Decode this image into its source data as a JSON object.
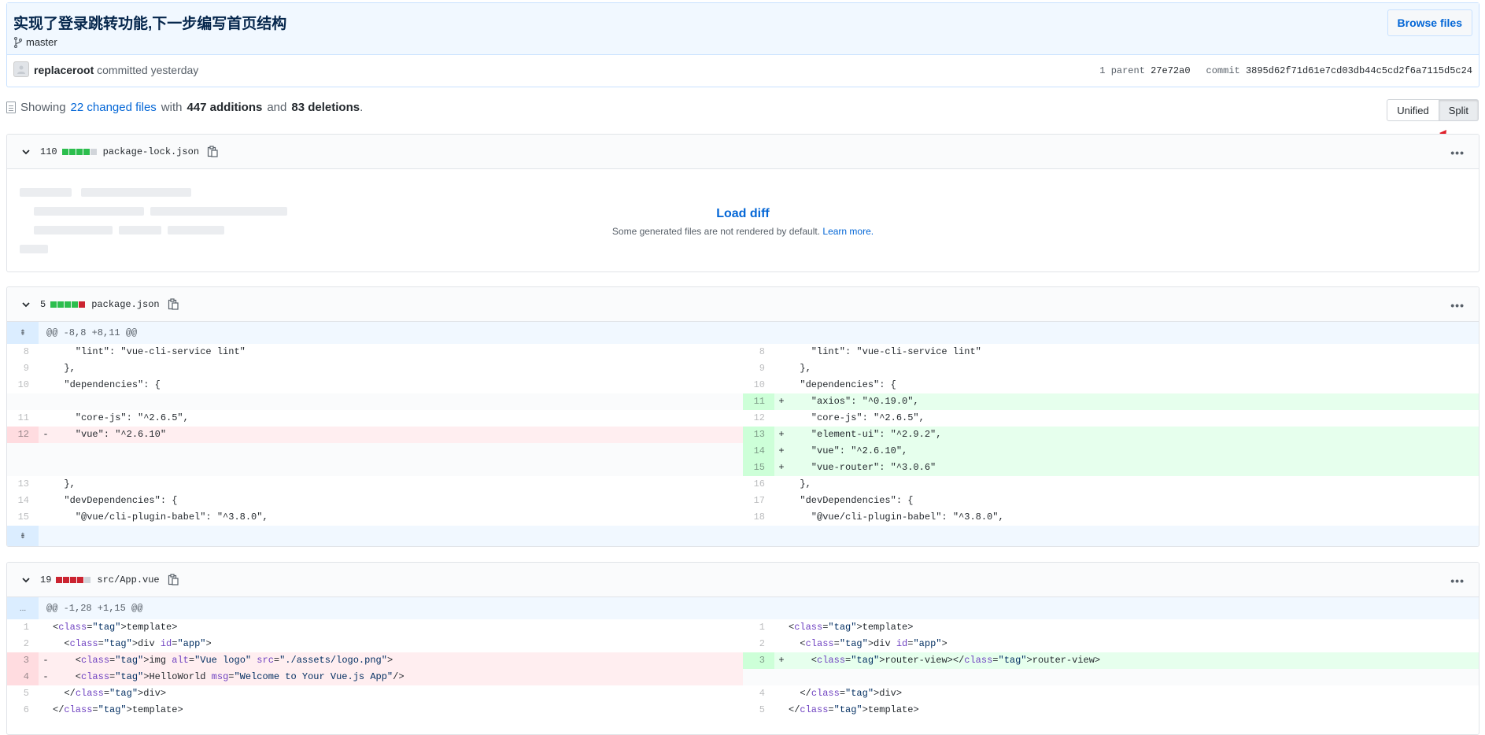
{
  "commit": {
    "title": "实现了登录跳转功能,下一步编写首页结构",
    "branch": "master",
    "browse_label": "Browse files",
    "author": "replaceroot",
    "action": "committed yesterday",
    "parent_label": "1 parent",
    "parent_sha": "27e72a0",
    "commit_label": "commit",
    "commit_sha": "3895d62f71d61e7cd03db44c5cd2f6a7115d5c24"
  },
  "toc": {
    "prefix": "Showing",
    "changed_files": "22 changed files",
    "with": "with",
    "additions": "447 additions",
    "and": "and",
    "deletions": "83 deletions",
    "period": "."
  },
  "view_toggle": {
    "unified": "Unified",
    "split": "Split"
  },
  "colors": {
    "add_block": "#2cbe4e",
    "del_block": "#cb2431",
    "neutral_block": "#d1d5da",
    "arrow": "#e0202a"
  },
  "files": [
    {
      "count": "110",
      "name": "package-lock.json",
      "blocks": [
        "add",
        "add",
        "add",
        "add",
        "neutral"
      ],
      "load_link": "Load diff",
      "load_note": "Some generated files are not rendered by default.",
      "load_note_link": "Learn more."
    },
    {
      "count": "5",
      "name": "package.json",
      "blocks": [
        "add",
        "add",
        "add",
        "add",
        "del"
      ],
      "hunk": "@@ -8,8 +8,11 @@",
      "rows": [
        {
          "ln": "8",
          "lt": "ctx",
          "lc": "    \"lint\": \"vue-cli-service lint\"",
          "rn": "8",
          "rt": "ctx",
          "rc": "    \"lint\": \"vue-cli-service lint\""
        },
        {
          "ln": "9",
          "lt": "ctx",
          "lc": "  },",
          "rn": "9",
          "rt": "ctx",
          "rc": "  },"
        },
        {
          "ln": "10",
          "lt": "ctx",
          "lc": "  \"dependencies\": {",
          "rn": "10",
          "rt": "ctx",
          "rc": "  \"dependencies\": {"
        },
        {
          "ln": "",
          "lt": "empty",
          "lc": "",
          "rn": "11",
          "rt": "add",
          "rc": "    \"axios\": \"^0.19.0\","
        },
        {
          "ln": "11",
          "lt": "ctx",
          "lc": "    \"core-js\": \"^2.6.5\",",
          "rn": "12",
          "rt": "ctx",
          "rc": "    \"core-js\": \"^2.6.5\","
        },
        {
          "ln": "12",
          "lt": "del",
          "lc": "    \"vue\": \"^2.6.10\"",
          "rn": "13",
          "rt": "add",
          "rc": "    \"element-ui\": \"^2.9.2\","
        },
        {
          "ln": "",
          "lt": "empty",
          "lc": "",
          "rn": "14",
          "rt": "add",
          "rc": "    \"vue\": \"^2.6.10\","
        },
        {
          "ln": "",
          "lt": "empty",
          "lc": "",
          "rn": "15",
          "rt": "add",
          "rc": "    \"vue-router\": \"^3.0.6\""
        },
        {
          "ln": "13",
          "lt": "ctx",
          "lc": "  },",
          "rn": "16",
          "rt": "ctx",
          "rc": "  },"
        },
        {
          "ln": "14",
          "lt": "ctx",
          "lc": "  \"devDependencies\": {",
          "rn": "17",
          "rt": "ctx",
          "rc": "  \"devDependencies\": {"
        },
        {
          "ln": "15",
          "lt": "ctx",
          "lc": "    \"@vue/cli-plugin-babel\": \"^3.8.0\",",
          "rn": "18",
          "rt": "ctx",
          "rc": "    \"@vue/cli-plugin-babel\": \"^3.8.0\","
        }
      ]
    },
    {
      "count": "19",
      "name": "src/App.vue",
      "blocks": [
        "del",
        "del",
        "del",
        "del",
        "neutral"
      ],
      "hunk": "@@ -1,28 +1,15 @@",
      "hunk_expander": "...",
      "rows": [
        {
          "ln": "1",
          "lt": "ctx",
          "lc": "<template>",
          "rn": "1",
          "rt": "ctx",
          "rc": "<template>"
        },
        {
          "ln": "2",
          "lt": "ctx",
          "lc": "  <div id=\"app\">",
          "rn": "2",
          "rt": "ctx",
          "rc": "  <div id=\"app\">"
        },
        {
          "ln": "3",
          "lt": "del",
          "lc": "    <img alt=\"Vue logo\" src=\"./assets/logo.png\">",
          "rn": "3",
          "rt": "add",
          "rc": "    <router-view></router-view>"
        },
        {
          "ln": "4",
          "lt": "del",
          "lc": "    <HelloWorld msg=\"Welcome to Your Vue.js App\"/>",
          "rn": "",
          "rt": "empty",
          "rc": ""
        },
        {
          "ln": "5",
          "lt": "ctx",
          "lc": "  </div>",
          "rn": "4",
          "rt": "ctx",
          "rc": "  </div>"
        },
        {
          "ln": "6",
          "lt": "ctx",
          "lc": "</template>",
          "rn": "5",
          "rt": "ctx",
          "rc": "</template>"
        }
      ]
    }
  ]
}
